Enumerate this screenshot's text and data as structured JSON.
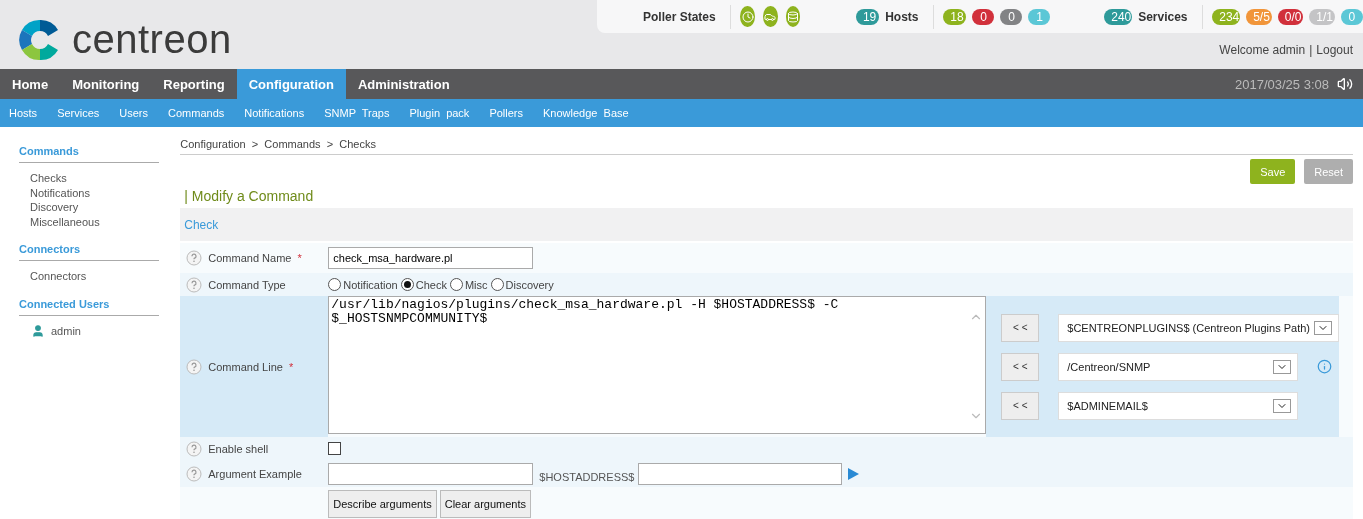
{
  "logo": {
    "text": "centreon"
  },
  "status": {
    "poller_label": "Poller States",
    "hosts": {
      "total": "19",
      "label": "Hosts",
      "counts": [
        {
          "text": "18",
          "color": "#8eb31e"
        },
        {
          "text": "0",
          "color": "#d1303b"
        },
        {
          "text": "0",
          "color": "#828385"
        },
        {
          "text": "1",
          "color": "#5bc7d6"
        }
      ]
    },
    "services": {
      "total": "240",
      "label": "Services",
      "counts": [
        {
          "text": "234",
          "color": "#8eb31e"
        },
        {
          "text": "5/5",
          "color": "#f1953a"
        },
        {
          "text": "0/0",
          "color": "#d1303b"
        },
        {
          "text": "1/1",
          "color": "#c4c4c6"
        },
        {
          "text": "0",
          "color": "#5bc7d6"
        }
      ]
    }
  },
  "user": {
    "welcome": "Welcome admin",
    "separator": "|",
    "logout": "Logout"
  },
  "nav": [
    {
      "label": "Home",
      "selected": false
    },
    {
      "label": "Monitoring",
      "selected": false
    },
    {
      "label": "Reporting",
      "selected": false
    },
    {
      "label": "Configuration",
      "selected": true
    },
    {
      "label": "Administration",
      "selected": false
    }
  ],
  "datetime": "2017/03/25 3:08",
  "subnav": [
    "Hosts",
    "Services",
    "Users",
    "Commands",
    "Notifications",
    "SNMP  Traps",
    "Plugin  pack",
    "Pollers",
    "Knowledge  Base"
  ],
  "sidebar": [
    {
      "title": "Commands",
      "kind": "links",
      "items": [
        "Checks",
        "Notifications",
        "Discovery",
        "Miscellaneous"
      ]
    },
    {
      "title": "Connectors",
      "kind": "links",
      "items": [
        "Connectors"
      ]
    },
    {
      "title": "Connected Users",
      "kind": "users",
      "items": [
        "admin"
      ]
    }
  ],
  "breadcrumb": "Configuration  >  Commands  >  Checks",
  "actions": [
    {
      "label": "Save",
      "kind": "primary"
    },
    {
      "label": "Reset",
      "kind": "secondary"
    }
  ],
  "form_title": "| Modify a Command",
  "section": "Check",
  "rows": [
    {
      "kind": "text",
      "label": "Command Name",
      "required_mark": "*",
      "value": "check_msa_hardware.pl"
    },
    {
      "kind": "radio",
      "label": "Command Type",
      "options": [
        {
          "label": "Notification",
          "selected": false
        },
        {
          "label": "Check",
          "selected": true
        },
        {
          "label": "Misc",
          "selected": false
        },
        {
          "label": "Discovery",
          "selected": false
        }
      ]
    },
    {
      "kind": "commandline",
      "label": "Command Line",
      "required_mark": "*",
      "value": "/usr/lib/nagios/plugins/check_msa_hardware.pl -H $HOSTADDRESS$ -C $_HOSTSNMPCOMMUNITY$",
      "macros": [
        {
          "button": "< <",
          "value": "$CENTREONPLUGINS$ (Centreon Plugins Path)",
          "info": false
        },
        {
          "button": "< <",
          "value": "/Centreon/SNMP",
          "info": true
        },
        {
          "button": "< <",
          "value": "$ADMINEMAIL$",
          "info": false
        }
      ]
    },
    {
      "kind": "checkbox",
      "label": "Enable shell",
      "checked": false
    },
    {
      "kind": "argument",
      "label": "Argument Example",
      "middle": "$HOSTADDRESS$"
    },
    {
      "kind": "buttons",
      "buttons": [
        "Describe arguments",
        "Clear arguments"
      ]
    }
  ]
}
